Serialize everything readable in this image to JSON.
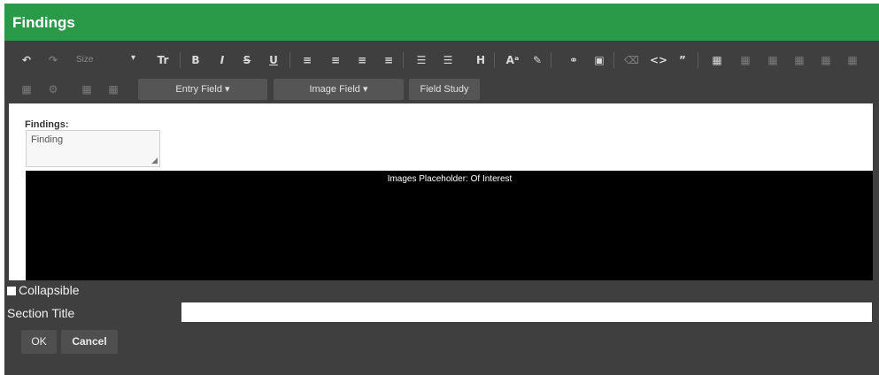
{
  "title": "Findings",
  "toolbar": {
    "size_label": "Size",
    "entry_field": "Entry Field",
    "image_field": "Image Field",
    "field_study": "Field Study",
    "caret": "▾"
  },
  "editor": {
    "findings_label": "Findings:",
    "findings_value": "Finding",
    "images_placeholder": "Images Placeholder: Of Interest"
  },
  "footer": {
    "collapsible_label": "Collapsible",
    "collapsible_checked": false,
    "section_title_label": "Section Title",
    "section_title_value": "",
    "ok_label": "OK",
    "cancel_label": "Cancel"
  },
  "colors": {
    "title_bar": "#2b9a48",
    "dialog_bg": "#3f3f3f",
    "editor_bg": "#ffffff"
  }
}
